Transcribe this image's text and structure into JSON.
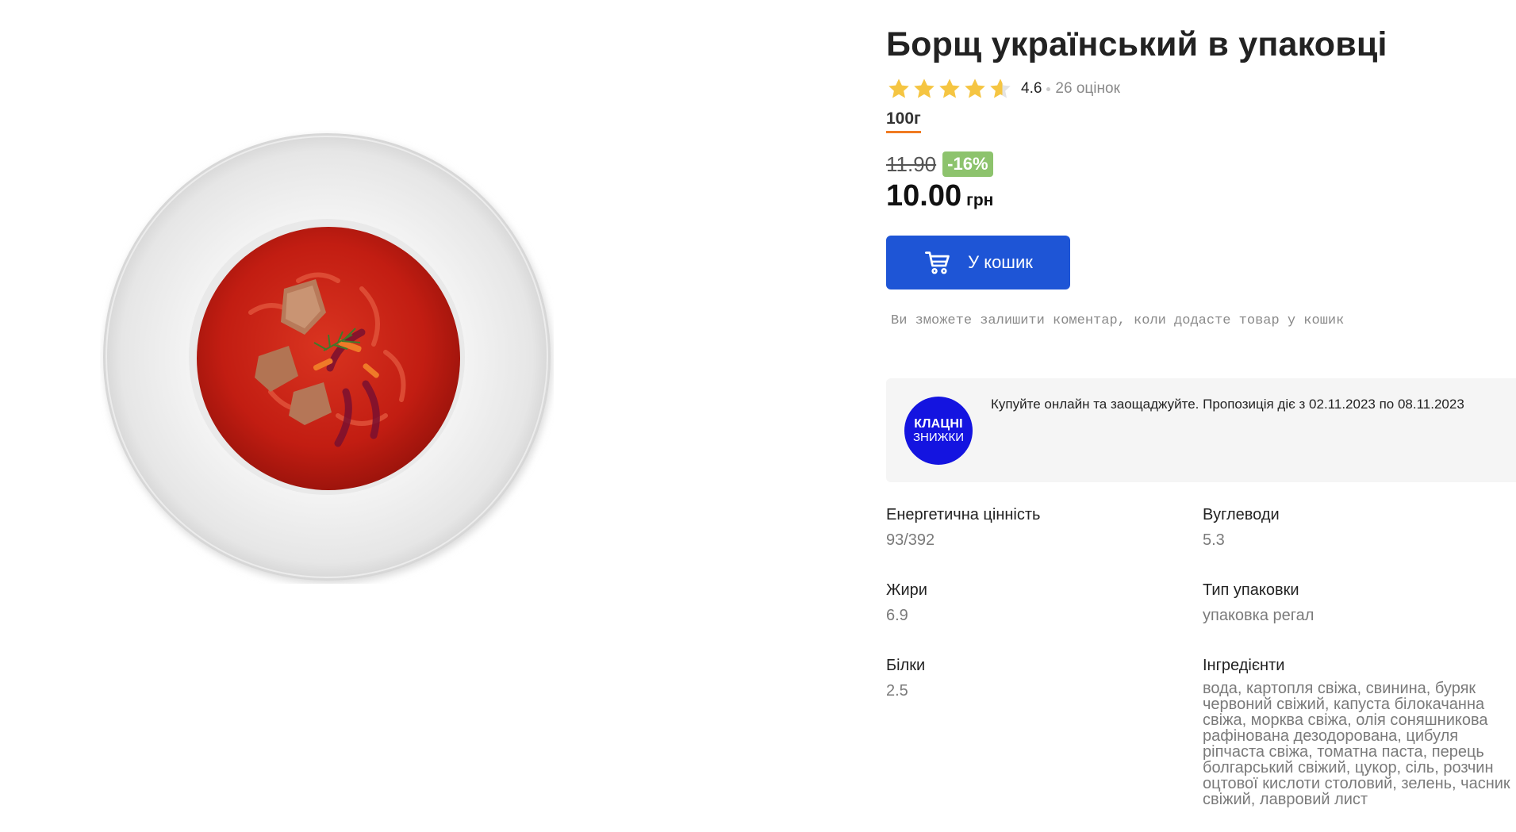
{
  "product": {
    "title": "Борщ український в упаковці",
    "image_alt": "plate-of-borscht",
    "rating": {
      "stars": 4.6,
      "value_label": "4.6",
      "count_label": "26 оцінок"
    },
    "weight_option": "100г",
    "price": {
      "old": "11.90",
      "discount": "-16%",
      "current": "10.00",
      "currency": "грн"
    },
    "cart_button_label": "У кошик",
    "comment_hint": "Ви зможете залишити коментар, коли додасте товар у кошик",
    "promo": {
      "logo_top": "КЛАЦНІ",
      "logo_bottom": "ЗНИЖКИ",
      "text": "Купуйте онлайн та заощаджуйте. Пропозиція діє з 02.11.2023 по 08.11.2023"
    },
    "specs": [
      {
        "label": "Енергетична цінність",
        "value": "93/392"
      },
      {
        "label": "Вуглеводи",
        "value": "5.3"
      },
      {
        "label": "Жири",
        "value": "6.9"
      },
      {
        "label": "Тип упаковки",
        "value": "упаковка регал"
      },
      {
        "label": "Білки",
        "value": "2.5"
      },
      {
        "label": "Інгредієнти",
        "value": "вода, картопля свіжа, свинина, буряк червоний свіжий, капуста білокачанна свіжа, морква свіжа, олія соняшникова рафінована дезодорована, цибуля ріпчаста свіжа, томатна паста, перець болгарський свіжий, цукор, сіль, розчин оцтової кислоти столовий, зелень, часник свіжий, лавровий лист"
      }
    ]
  },
  "colors": {
    "accent_blue": "#1e55d6",
    "discount_green": "#8dc36d",
    "star_gold": "#f5c542",
    "weight_underline": "#f07b22",
    "promo_logo_blue": "#1414e0"
  },
  "icons": {
    "cart": "cart-icon",
    "star": "star-icon"
  }
}
